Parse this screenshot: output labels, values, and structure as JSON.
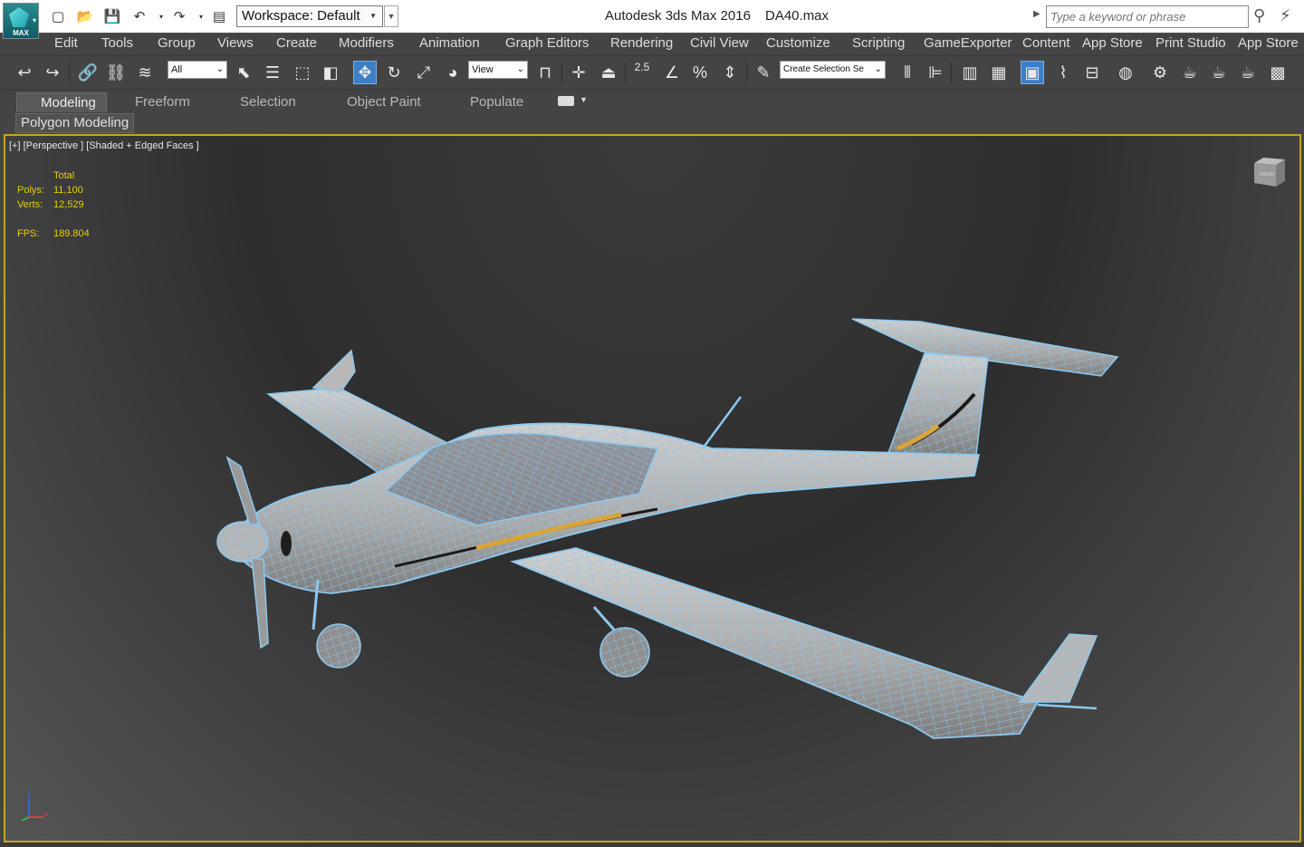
{
  "app": {
    "logo_text": "MAX",
    "title": "Autodesk 3ds Max 2016",
    "filename": "DA40.max"
  },
  "quick_access": {
    "workspace": "Workspace: Default"
  },
  "search": {
    "placeholder": "Type a keyword or phrase"
  },
  "menubar": {
    "items": [
      "Edit",
      "Tools",
      "Group",
      "Views",
      "Create",
      "Modifiers",
      "Animation",
      "Graph Editors",
      "Rendering",
      "Civil View",
      "Customize",
      "Scripting",
      "GameExporter",
      "Content",
      "App Store",
      "Print Studio",
      "App Store"
    ]
  },
  "toolbar": {
    "selection_filter": "All",
    "reference_coord": "View",
    "snap_angle_label": "2.5",
    "named_selection": "Create Selection Se"
  },
  "ribbon": {
    "tabs": [
      "Modeling",
      "Freeform",
      "Selection",
      "Object Paint",
      "Populate"
    ],
    "active_tab": "Modeling",
    "subtab": "Polygon Modeling"
  },
  "viewport": {
    "label": "[+] [Perspective ] [Shaded + Edged Faces ]",
    "viewcube_label": "FRONT",
    "stats": {
      "header": "Total",
      "polys_label": "Polys:",
      "polys_value": "11,100",
      "verts_label": "Verts:",
      "verts_value": "12,529",
      "fps_label": "FPS:",
      "fps_value": "189.804"
    },
    "axis": {
      "z": "z",
      "x": "x"
    }
  },
  "colors": {
    "viewport_border": "#c9a227",
    "wireframe": "#8cc8ee",
    "stats_text": "#e8d000",
    "active_tool": "#3d7fc4"
  }
}
